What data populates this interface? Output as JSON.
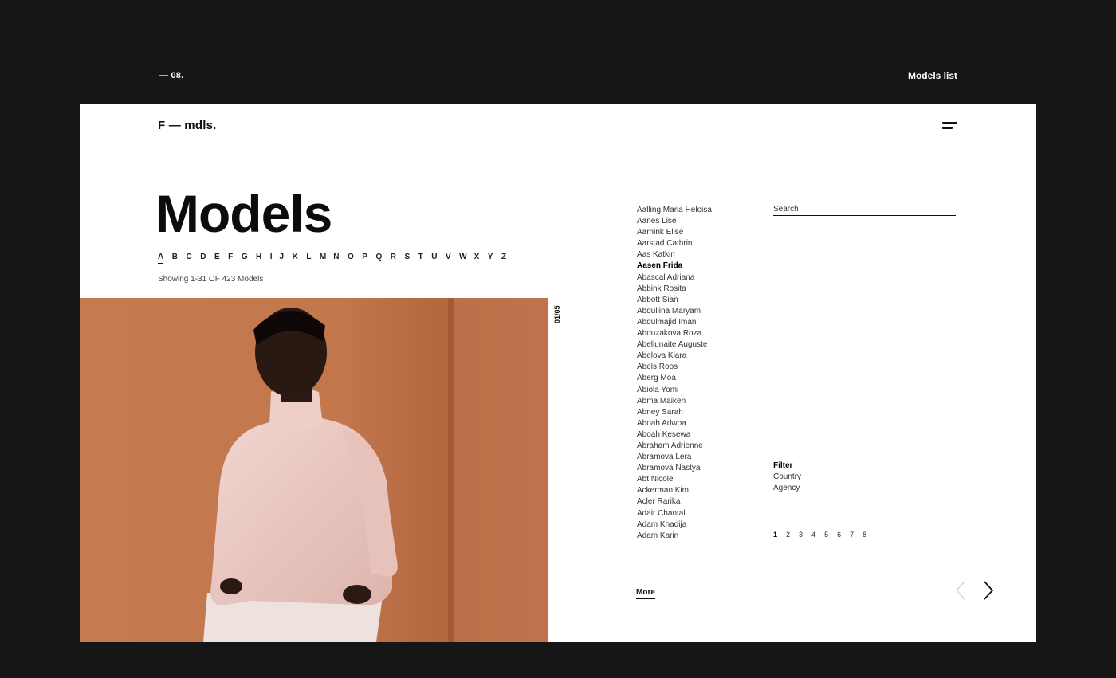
{
  "outer": {
    "index": "— 08.",
    "title": "Models list"
  },
  "header": {
    "logo": "F — mdls."
  },
  "main": {
    "title": "Models",
    "alphabet": [
      "A",
      "B",
      "C",
      "D",
      "E",
      "F",
      "G",
      "H",
      "I",
      "J",
      "K",
      "L",
      "M",
      "N",
      "O",
      "P",
      "Q",
      "R",
      "S",
      "T",
      "U",
      "V",
      "W",
      "X",
      "Y",
      "Z"
    ],
    "active_letter": "A",
    "showing": "Showing 1-31 OF 423 Models",
    "slide_counter": "01/05"
  },
  "models": [
    "Aalling  Maria Heloisa",
    "Aanes Lise",
    "Aarnink Elise",
    "Aarstad Cathrin",
    "Aas Katkin",
    "Aasen Frida",
    "Abascal Adriana",
    "Abbink Rosita",
    "Abbott Sian",
    "Abdullina Maryam",
    "Abdulmajid Iman",
    "Abduzakova Roza",
    "Abeliunaite Auguste",
    "Abelova Klara",
    "Abels Roos",
    "Aberg Moa",
    "Abiola Yomi",
    "Abma Maiken",
    "Abney Sarah",
    "Aboah Adwoa",
    "Aboah Kesewa",
    "Abraham Adrienne",
    "Abramova Lera",
    "Abramova Nastya",
    "Abt Nicole",
    "Ackerman Kim",
    "Acler Rarika",
    "Adair Chantal",
    "Adam Khadija",
    "Adam Karin"
  ],
  "active_model": "Aasen Frida",
  "search": {
    "placeholder": "Search"
  },
  "filter": {
    "title": "Filter",
    "options": [
      "Country",
      "Agency"
    ]
  },
  "pagination": {
    "pages": [
      "1",
      "2",
      "3",
      "4",
      "5",
      "6",
      "7",
      "8"
    ],
    "current": "1"
  },
  "more_label": "More",
  "colors": {
    "page_bg": "#161616",
    "card_bg": "#ffffff",
    "photo_wall": "#c4784f"
  }
}
